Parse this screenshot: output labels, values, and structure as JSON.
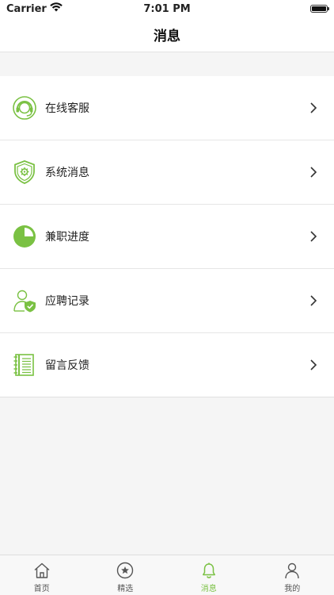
{
  "status_bar": {
    "carrier": "Carrier",
    "time": "7:01 PM"
  },
  "header": {
    "title": "消息"
  },
  "colors": {
    "accent": "#7ac143",
    "tab_inactive": "#555555"
  },
  "menu": {
    "items": [
      {
        "label": "在线客服",
        "icon": "headset-icon"
      },
      {
        "label": "系统消息",
        "icon": "shield-gear-icon"
      },
      {
        "label": "兼职进度",
        "icon": "progress-pie-icon"
      },
      {
        "label": "应聘记录",
        "icon": "user-shield-icon"
      },
      {
        "label": "留言反馈",
        "icon": "notebook-icon"
      }
    ]
  },
  "tab_bar": {
    "tabs": [
      {
        "label": "首页",
        "icon": "home-icon",
        "active": false
      },
      {
        "label": "精选",
        "icon": "star-circle-icon",
        "active": false
      },
      {
        "label": "消息",
        "icon": "bell-icon",
        "active": true
      },
      {
        "label": "我的",
        "icon": "person-icon",
        "active": false
      }
    ]
  }
}
